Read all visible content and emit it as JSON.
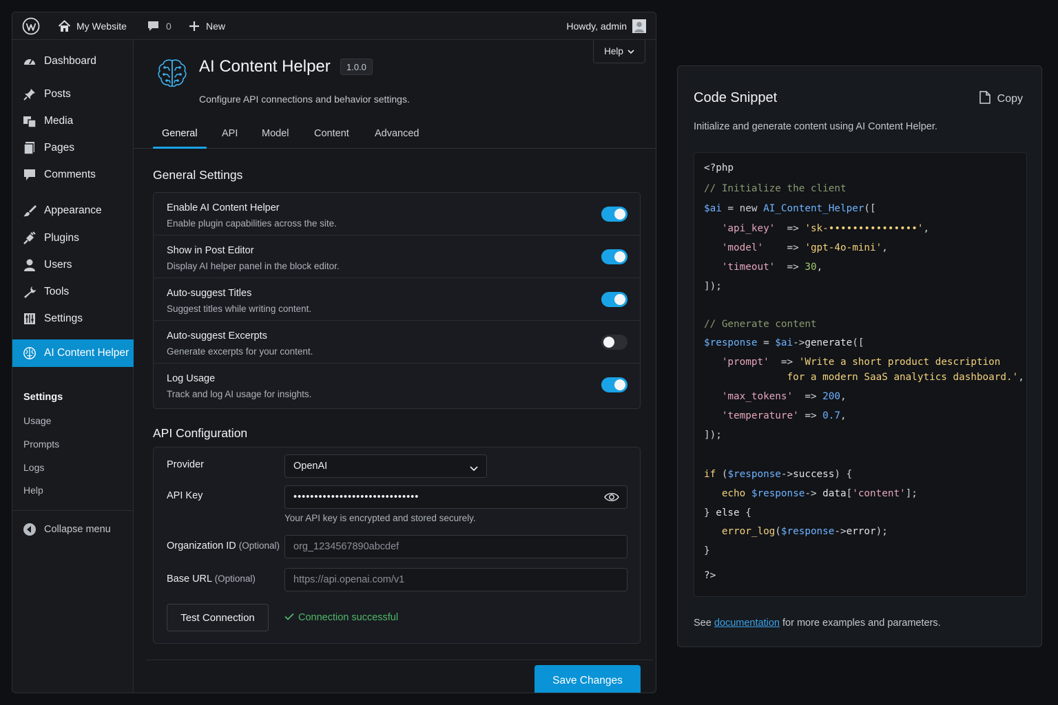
{
  "admin_bar": {
    "site_name": "My Website",
    "comments_count": "0",
    "new_label": "New",
    "greeting": "Howdy, admin"
  },
  "sidebar": {
    "items": [
      {
        "label": "Dashboard",
        "icon": "dashboard-icon"
      },
      {
        "label": "Posts",
        "icon": "pin-icon"
      },
      {
        "label": "Media",
        "icon": "media-icon"
      },
      {
        "label": "Pages",
        "icon": "pages-icon"
      },
      {
        "label": "Comments",
        "icon": "comment-icon"
      },
      {
        "label": "Appearance",
        "icon": "brush-icon"
      },
      {
        "label": "Plugins",
        "icon": "plugin-icon"
      },
      {
        "label": "Users",
        "icon": "user-icon"
      },
      {
        "label": "Tools",
        "icon": "wrench-icon"
      },
      {
        "label": "Settings",
        "icon": "settings-icon"
      },
      {
        "label": "AI Content Helper",
        "icon": "brain-icon",
        "active": true
      }
    ],
    "submenu": [
      {
        "label": "Settings",
        "current": true
      },
      {
        "label": "Usage"
      },
      {
        "label": "Prompts"
      },
      {
        "label": "Logs"
      },
      {
        "label": "Help"
      }
    ],
    "collapse_label": "Collapse menu"
  },
  "header": {
    "help_label": "Help",
    "title": "AI Content Helper",
    "version": "1.0.0",
    "description": "Configure API connections and behavior settings."
  },
  "tabs": [
    {
      "label": "General",
      "active": true
    },
    {
      "label": "API"
    },
    {
      "label": "Model"
    },
    {
      "label": "Content"
    },
    {
      "label": "Advanced"
    }
  ],
  "general": {
    "title": "General Settings",
    "settings": [
      {
        "title": "Enable AI Content Helper",
        "desc": "Enable plugin capabilities across the site.",
        "on": true
      },
      {
        "title": "Show in Post Editor",
        "desc": "Display AI helper panel in the block editor.",
        "on": true
      },
      {
        "title": "Auto-suggest Titles",
        "desc": "Suggest titles while writing content.",
        "on": true
      },
      {
        "title": "Auto-suggest Excerpts",
        "desc": "Generate excerpts for your content.",
        "on": false
      },
      {
        "title": "Log Usage",
        "desc": "Track and log AI usage for insights.",
        "on": true
      }
    ]
  },
  "api": {
    "title": "API Configuration",
    "provider_label": "Provider",
    "provider_value": "OpenAI",
    "api_key_label": "API Key",
    "api_key_value": "••••••••••••••••••••••••••••••",
    "api_key_help": "Your API key is encrypted and stored securely.",
    "org_label": "Organization ID",
    "org_optional": "(Optional)",
    "org_placeholder": "org_1234567890abcdef",
    "base_label": "Base URL",
    "base_optional": "(Optional)",
    "base_placeholder": "https://api.openai.com/v1",
    "test_button": "Test Connection",
    "status": "Connection successful"
  },
  "save_button": "Save Changes",
  "code_panel": {
    "title": "Code Snippet",
    "copy_label": "Copy",
    "description": "Initialize and generate content using AI Content Helper.",
    "footer_prefix": "See",
    "footer_link": "documentation",
    "footer_suffix": "for more examples and parameters.",
    "lines": [
      [
        [
          "<?php",
          "plain"
        ]
      ],
      [
        [
          "// Initialize the client",
          "comment"
        ]
      ],
      [
        [
          "$ai",
          "var"
        ],
        [
          " = new ",
          "op"
        ],
        [
          "AI_Content_Helper",
          "var"
        ],
        [
          "([",
          "op"
        ]
      ],
      [
        [
          "   'api_key'",
          "key"
        ],
        [
          "  => ",
          "op"
        ],
        [
          "'sk-•••••••••••••••'",
          "str"
        ],
        [
          ",",
          "op"
        ]
      ],
      [
        [
          "   'model'",
          "key"
        ],
        [
          "    => ",
          "op"
        ],
        [
          "'gpt-4o-mini'",
          "str"
        ],
        [
          ",",
          "op"
        ]
      ],
      [
        [
          "   'timeout'",
          "key"
        ],
        [
          "  => ",
          "op"
        ],
        [
          "30",
          "num"
        ],
        [
          ",",
          "op"
        ]
      ],
      [
        [
          "]);",
          "op"
        ]
      ],
      [
        [
          "",
          "plain"
        ]
      ],
      [
        [
          "// Generate content",
          "comment"
        ]
      ],
      [
        [
          "$response",
          "var"
        ],
        [
          " = ",
          "op"
        ],
        [
          "$ai",
          "var"
        ],
        [
          "->",
          "op"
        ],
        [
          "generate",
          "plain"
        ],
        [
          "([",
          "op"
        ]
      ],
      [
        [
          "   'prompt'",
          "key"
        ],
        [
          "  => ",
          "op"
        ],
        [
          "'Write a short product description",
          "str"
        ]
      ],
      [
        [
          "              for a modern SaaS analytics dashboard.'",
          "str"
        ],
        [
          ",",
          "op"
        ]
      ],
      [
        [
          "   'max_tokens'",
          "key"
        ],
        [
          "  => ",
          "op"
        ],
        [
          "200",
          "var"
        ],
        [
          ",",
          "op"
        ]
      ],
      [
        [
          "   'temperature'",
          "key"
        ],
        [
          " => ",
          "op"
        ],
        [
          "0.7",
          "var"
        ],
        [
          ",",
          "op"
        ]
      ],
      [
        [
          "]);",
          "op"
        ]
      ],
      [
        [
          "",
          "plain"
        ]
      ],
      [
        [
          "if",
          "str"
        ],
        [
          " (",
          "op"
        ],
        [
          "$response",
          "var"
        ],
        [
          "->",
          "op"
        ],
        [
          "success",
          "plain"
        ],
        [
          ") {",
          "op"
        ]
      ],
      [
        [
          "   echo ",
          "str"
        ],
        [
          "$response",
          "var"
        ],
        [
          "->",
          "op"
        ],
        [
          " data",
          "plain"
        ],
        [
          "[",
          "op"
        ],
        [
          "'content'",
          "key"
        ],
        [
          "];",
          "op"
        ]
      ],
      [
        [
          "} ",
          "op"
        ],
        [
          "else",
          "plain"
        ],
        [
          " {",
          "op"
        ]
      ],
      [
        [
          "   error_log",
          "str"
        ],
        [
          "(",
          "op"
        ],
        [
          "$response",
          "var"
        ],
        [
          "->",
          "op"
        ],
        [
          "error",
          "plain"
        ],
        [
          ");",
          "op"
        ]
      ],
      [
        [
          "}",
          "op"
        ]
      ],
      [
        [
          "?>",
          "plain"
        ]
      ]
    ]
  }
}
